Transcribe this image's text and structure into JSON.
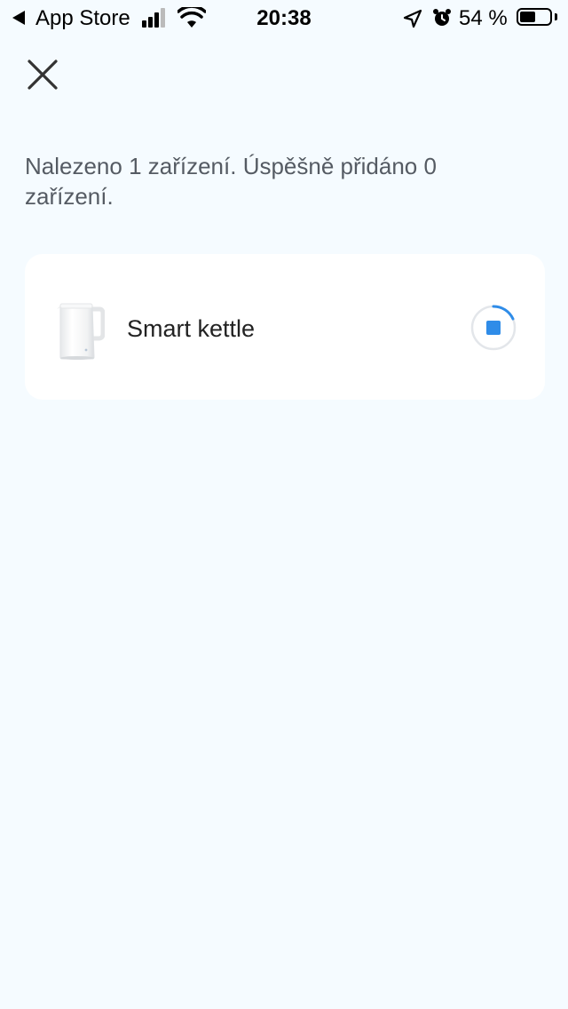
{
  "status_bar": {
    "back_app": "App Store",
    "time": "20:38",
    "battery_percent": "54 %",
    "battery_level": 0.54
  },
  "header": {
    "close_icon": "close-icon"
  },
  "message": "Nalezeno 1 zařízení. Úspěšně přidáno 0 zařízení.",
  "devices": [
    {
      "name": "Smart kettle",
      "icon": "kettle-image",
      "action_icon": "stop-progress-icon"
    }
  ],
  "colors": {
    "background": "#f5fbff",
    "card": "#ffffff",
    "accent": "#2f8ce8",
    "message_text": "#555b63"
  }
}
